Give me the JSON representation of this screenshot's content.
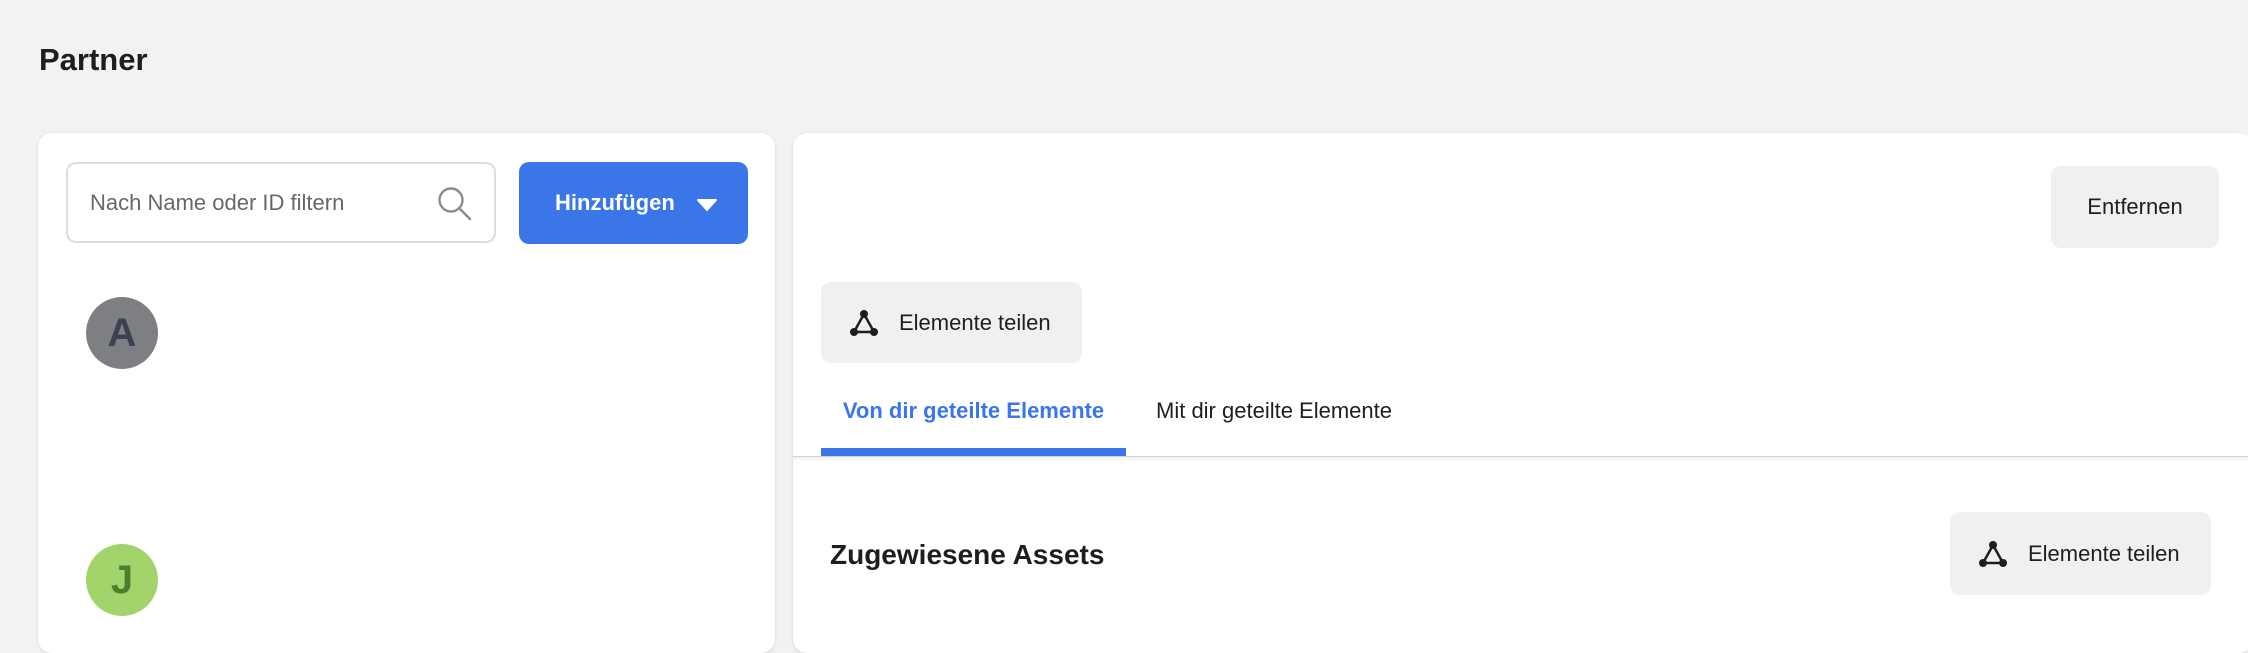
{
  "page": {
    "title": "Partner"
  },
  "left_panel": {
    "search": {
      "placeholder": "Nach Name oder ID filtern",
      "value": ""
    },
    "add_button": {
      "label": "Hinzufügen"
    },
    "partners": [
      {
        "initial": "A",
        "color": "#7d7f83"
      },
      {
        "initial": "J",
        "color": "#a3d46c"
      }
    ]
  },
  "right_panel": {
    "remove_button": {
      "label": "Entfernen"
    },
    "share_button": {
      "label": "Elemente teilen",
      "icon": "share-network-icon"
    },
    "tabs": [
      {
        "label": "Von dir geteilte Elemente",
        "active": true
      },
      {
        "label": "Mit dir geteilte Elemente",
        "active": false
      }
    ],
    "section": {
      "title": "Zugewiesene Assets",
      "share_button": {
        "label": "Elemente teilen",
        "icon": "share-network-icon"
      }
    }
  },
  "colors": {
    "accent": "#3b76e8",
    "background": "#f2f2f2",
    "button_gray": "#f0f0f0"
  }
}
